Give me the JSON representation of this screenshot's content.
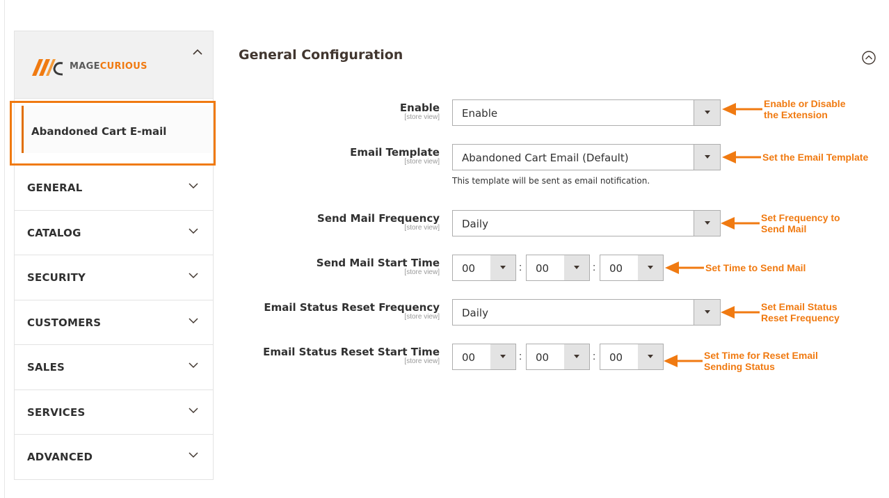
{
  "brand": {
    "name_part1": "MAGE",
    "name_part2": "CURIOUS"
  },
  "sidebar": {
    "active_item": "Abandoned Cart E-mail",
    "items": [
      {
        "label": "GENERAL"
      },
      {
        "label": "CATALOG"
      },
      {
        "label": "SECURITY"
      },
      {
        "label": "CUSTOMERS"
      },
      {
        "label": "SALES"
      },
      {
        "label": "SERVICES"
      },
      {
        "label": "ADVANCED"
      }
    ]
  },
  "section": {
    "title": "General Configuration"
  },
  "fields": {
    "enable": {
      "label": "Enable",
      "scope": "[store view]",
      "value": "Enable"
    },
    "email_template": {
      "label": "Email Template",
      "scope": "[store view]",
      "value": "Abandoned Cart Email (Default)",
      "note": "This template will be sent as email notification."
    },
    "send_mail_frequency": {
      "label": "Send Mail Frequency",
      "scope": "[store view]",
      "value": "Daily"
    },
    "send_mail_start_time": {
      "label": "Send Mail Start Time",
      "scope": "[store view]",
      "hour": "00",
      "minute": "00",
      "second": "00"
    },
    "reset_frequency": {
      "label": "Email Status Reset Frequency",
      "scope": "[store view]",
      "value": "Daily"
    },
    "reset_start_time": {
      "label": "Email Status Reset Start Time",
      "scope": "[store view]",
      "hour": "00",
      "minute": "00",
      "second": "00"
    }
  },
  "annotations": {
    "enable": "Enable or Disable\nthe Extension",
    "email_template": "Set the Email Template",
    "send_mail_frequency": "Set Frequency to\nSend Mail",
    "send_mail_start_time": "Set Time to Send Mail",
    "reset_frequency": "Set Email Status\nReset Frequency",
    "reset_start_time": "Set Time for Reset Email\nSending Status"
  },
  "colors": {
    "accent": "#f07a11",
    "active_bar": "#e16e00",
    "text": "#303030",
    "button_bg": "#e3e3e3"
  },
  "time_separator": ":"
}
